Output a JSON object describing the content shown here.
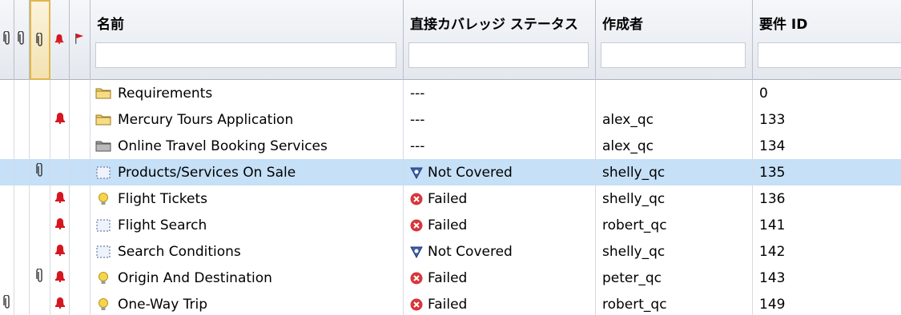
{
  "columns": {
    "name": "名前",
    "coverage": "直接カバレッジ ステータス",
    "author": "作成者",
    "req_id": "要件 ID"
  },
  "filters": {
    "name": "",
    "coverage": "",
    "author": "",
    "req_id": ""
  },
  "header_icons": [
    "attachment-icon",
    "attachment-icon",
    "alert-icon",
    "flag-icon"
  ],
  "rows": [
    {
      "attach1": false,
      "attach2": false,
      "alert": false,
      "type": "folder-icon",
      "name": "Requirements",
      "status_icon": "",
      "status": "---",
      "author": "",
      "id": "0"
    },
    {
      "attach1": false,
      "attach2": false,
      "alert": true,
      "type": "folder-icon",
      "name": "Mercury Tours Application",
      "status_icon": "",
      "status": "---",
      "author": "alex_qc",
      "id": "133"
    },
    {
      "attach1": false,
      "attach2": false,
      "alert": false,
      "type": "business-folder-icon",
      "name": "Online Travel Booking Services",
      "status_icon": "",
      "status": "---",
      "author": "alex_qc",
      "id": "134"
    },
    {
      "attach1": false,
      "attach2": true,
      "alert": false,
      "type": "requirement-icon",
      "name": "Products/Services On Sale",
      "status_icon": "not-covered-icon",
      "status": "Not Covered",
      "author": "shelly_qc",
      "id": "135",
      "selected": true
    },
    {
      "attach1": false,
      "attach2": false,
      "alert": true,
      "type": "functional-requirement-icon",
      "name": "Flight Tickets",
      "status_icon": "failed-icon",
      "status": "Failed",
      "author": "shelly_qc",
      "id": "136"
    },
    {
      "attach1": false,
      "attach2": false,
      "alert": true,
      "type": "requirement-icon",
      "name": "Flight Search",
      "status_icon": "failed-icon",
      "status": "Failed",
      "author": "robert_qc",
      "id": "141"
    },
    {
      "attach1": false,
      "attach2": false,
      "alert": true,
      "type": "requirement-icon",
      "name": "Search Conditions",
      "status_icon": "not-covered-icon",
      "status": "Not Covered",
      "author": "shelly_qc",
      "id": "142"
    },
    {
      "attach1": false,
      "attach2": true,
      "alert": true,
      "type": "functional-requirement-icon",
      "name": "Origin And Destination",
      "status_icon": "failed-icon",
      "status": "Failed",
      "author": "peter_qc",
      "id": "143"
    },
    {
      "attach1": true,
      "attach2": false,
      "alert": true,
      "type": "functional-requirement-icon",
      "name": "One-Way Trip",
      "status_icon": "failed-icon",
      "status": "Failed",
      "author": "robert_qc",
      "id": "149"
    }
  ],
  "colors": {
    "selected_row": "#c5e0f7",
    "alert": "#d6161f",
    "failed": "#d8363b",
    "not_covered": "#3d5fae",
    "folder": "#f2cf63"
  }
}
